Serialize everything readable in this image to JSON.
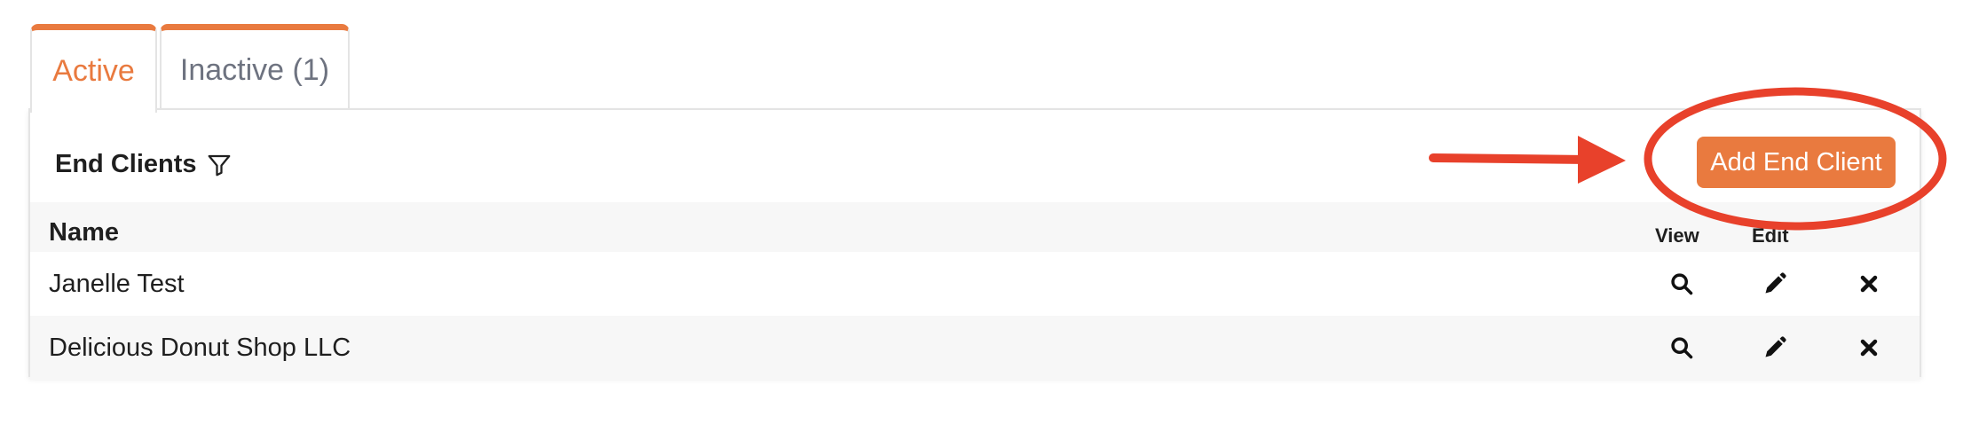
{
  "tabs": [
    {
      "label": "Active"
    },
    {
      "label": "Inactive (1)"
    }
  ],
  "panel": {
    "title": "End Clients",
    "add_button_label": "Add End Client"
  },
  "table": {
    "headers": {
      "name": "Name",
      "view": "View",
      "edit": "Edit"
    },
    "rows": [
      {
        "name": "Janelle Test"
      },
      {
        "name": "Delicious Donut Shop LLC"
      }
    ]
  },
  "icons": {
    "filter": "filter-icon",
    "view": "search-icon",
    "edit": "pencil-icon",
    "delete": "close-icon"
  },
  "colors": {
    "accent": "#e97a3f",
    "annotation": "#e8412b",
    "inactive_tab_text": "#6e7380"
  }
}
